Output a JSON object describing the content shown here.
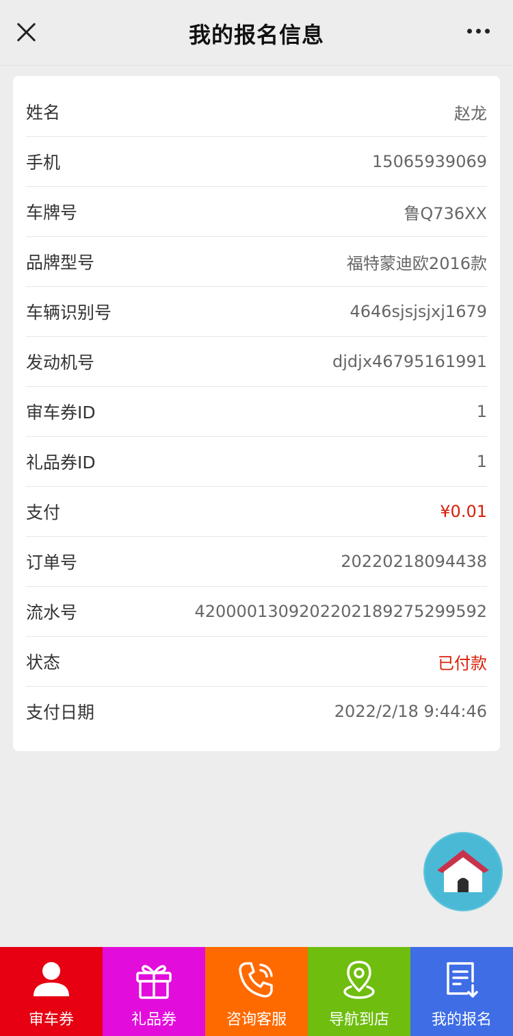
{
  "header": {
    "title": "我的报名信息",
    "close_icon": "close-icon",
    "more_icon": "more-icon"
  },
  "info": {
    "rows": [
      {
        "label": "姓名",
        "value": "赵龙"
      },
      {
        "label": "手机",
        "value": "15065939069"
      },
      {
        "label": "车牌号",
        "value": "鲁Q736XX"
      },
      {
        "label": "品牌型号",
        "value": "福特蒙迪欧2016款"
      },
      {
        "label": "车辆识别号",
        "value": "4646sjsjsjxj1679"
      },
      {
        "label": "发动机号",
        "value": "djdjx46795161991"
      },
      {
        "label": "审车券ID",
        "value": "1"
      },
      {
        "label": "礼品券ID",
        "value": "1"
      },
      {
        "label": "支付",
        "value": "¥0.01"
      },
      {
        "label": "订单号",
        "value": "20220218094438"
      },
      {
        "label": "流水号",
        "value": "4200001309202202189275299592"
      },
      {
        "label": "状态",
        "value": "已付款"
      },
      {
        "label": "支付日期",
        "value": "2022/2/18 9:44:46"
      }
    ]
  },
  "home_button": {
    "icon": "home-icon"
  },
  "bottom_nav": {
    "items": [
      {
        "label": "审车券",
        "icon": "user-icon",
        "color": "#e60012"
      },
      {
        "label": "礼品券",
        "icon": "gift-icon",
        "color": "#e20ddb"
      },
      {
        "label": "咨询客服",
        "icon": "phone-icon",
        "color": "#ff6a00"
      },
      {
        "label": "导航到店",
        "icon": "location-icon",
        "color": "#6ebd0f"
      },
      {
        "label": "我的报名",
        "icon": "document-icon",
        "color": "#3f6de6"
      }
    ]
  },
  "colors": {
    "accent_red": "#d81e06",
    "background": "#ededed"
  }
}
